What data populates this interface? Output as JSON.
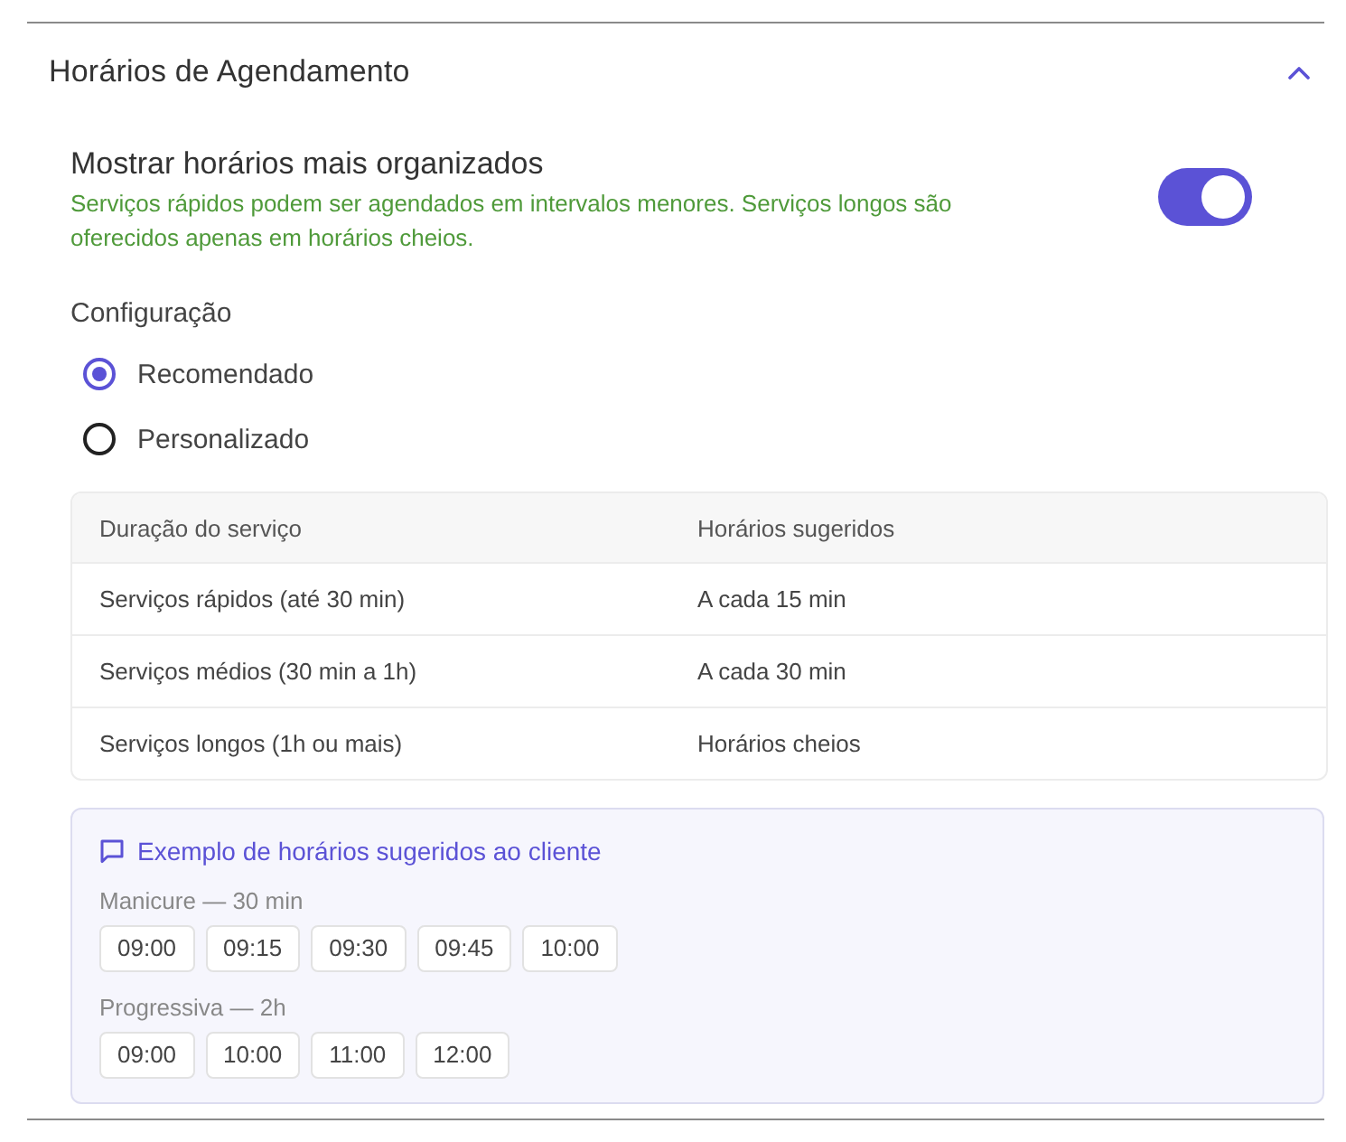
{
  "section": {
    "title": "Horários de Agendamento",
    "expanded": true
  },
  "setting": {
    "title": "Mostrar horários mais organizados",
    "description": "Serviços rápidos podem ser agendados em intervalos menores. Serviços longos são oferecidos apenas em horários cheios.",
    "on": true
  },
  "configuration": {
    "label": "Configuração",
    "options": [
      {
        "label": "Recomendado",
        "selected": true
      },
      {
        "label": "Personalizado",
        "selected": false
      }
    ]
  },
  "table": {
    "columns": [
      "Duração do serviço",
      "Horários sugeridos"
    ],
    "rows": [
      [
        "Serviços rápidos (até 30 min)",
        "A cada 15 min"
      ],
      [
        "Serviços médios (30 min a 1h)",
        "A cada 30 min"
      ],
      [
        "Serviços longos (1h ou mais)",
        "Horários cheios"
      ]
    ]
  },
  "example": {
    "title": "Exemplo de horários sugeridos ao cliente",
    "services": [
      {
        "label": "Manicure — 30 min",
        "slots": [
          "09:00",
          "09:15",
          "09:30",
          "09:45",
          "10:00"
        ]
      },
      {
        "label": "Progressiva — 2h",
        "slots": [
          "09:00",
          "10:00",
          "11:00",
          "12:00"
        ]
      }
    ]
  }
}
